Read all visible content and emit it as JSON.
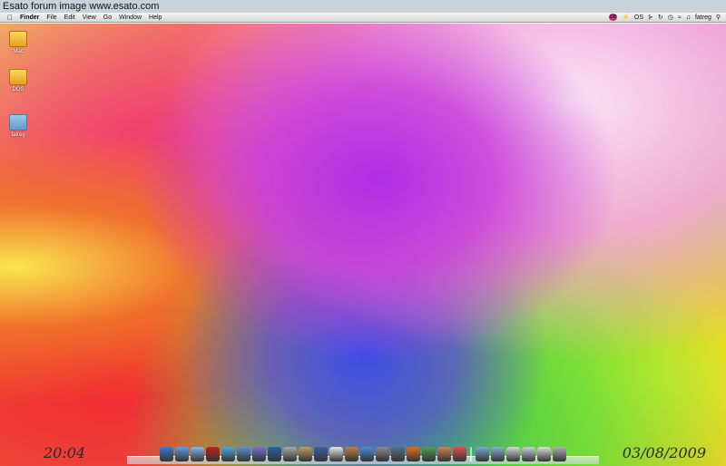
{
  "watermark": "Esato forum image www.esato.com",
  "menubar": {
    "app": "Finder",
    "items": [
      "File",
      "Edit",
      "View",
      "Go",
      "Window",
      "Help"
    ],
    "status_badge": "ce",
    "status_text": "OS",
    "user": "fatreg"
  },
  "desktop_icons": [
    {
      "label": "Mac",
      "type": "disk"
    },
    {
      "label": "DOS",
      "type": "disk"
    },
    {
      "label": "fatreg",
      "type": "folder"
    }
  ],
  "clock": "20:04",
  "date": "03/08/2009",
  "dock": {
    "apps": [
      {
        "icon": "finder-icon",
        "color": "#3a7bd5"
      },
      {
        "icon": "ichat-icon",
        "color": "#5aa0e6"
      },
      {
        "icon": "messages-icon",
        "color": "#7fb8f0"
      },
      {
        "icon": "record-icon",
        "color": "#c02020"
      },
      {
        "icon": "itunes-icon",
        "color": "#4aa8e8"
      },
      {
        "icon": "safari-icon",
        "color": "#5a8fd8"
      },
      {
        "icon": "spotlight-icon",
        "color": "#7b6fd6"
      },
      {
        "icon": "keychain-icon",
        "color": "#2c5fa8"
      },
      {
        "icon": "calculator-icon",
        "color": "#a8a8a8"
      },
      {
        "icon": "package-icon",
        "color": "#c49a5a"
      },
      {
        "icon": "pen-icon",
        "color": "#3a5fa0"
      },
      {
        "icon": "calendar-icon",
        "color": "#e8e8e8"
      },
      {
        "icon": "iphoto-icon",
        "color": "#c08040"
      },
      {
        "icon": "app-store-icon",
        "color": "#4a8ad8"
      },
      {
        "icon": "preview-icon",
        "color": "#8a8a8a"
      },
      {
        "icon": "time-machine-icon",
        "color": "#5a7080"
      },
      {
        "icon": "firefox-icon",
        "color": "#e07020"
      },
      {
        "icon": "games-icon",
        "color": "#50a050"
      },
      {
        "icon": "photos-icon",
        "color": "#d08050"
      },
      {
        "icon": "lifesaver-icon",
        "color": "#e05050"
      }
    ],
    "stacks": [
      {
        "icon": "applications-folder-icon",
        "color": "#7aaad8"
      },
      {
        "icon": "documents-folder-icon",
        "color": "#8ab0d0"
      },
      {
        "icon": "downloads-icon",
        "color": "#d8d8d8"
      },
      {
        "icon": "documents-stack-icon",
        "color": "#c8d0d8"
      },
      {
        "icon": "drive-icon",
        "color": "#e0e0e0"
      },
      {
        "icon": "trash-icon",
        "color": "#b0b0b0"
      }
    ]
  }
}
